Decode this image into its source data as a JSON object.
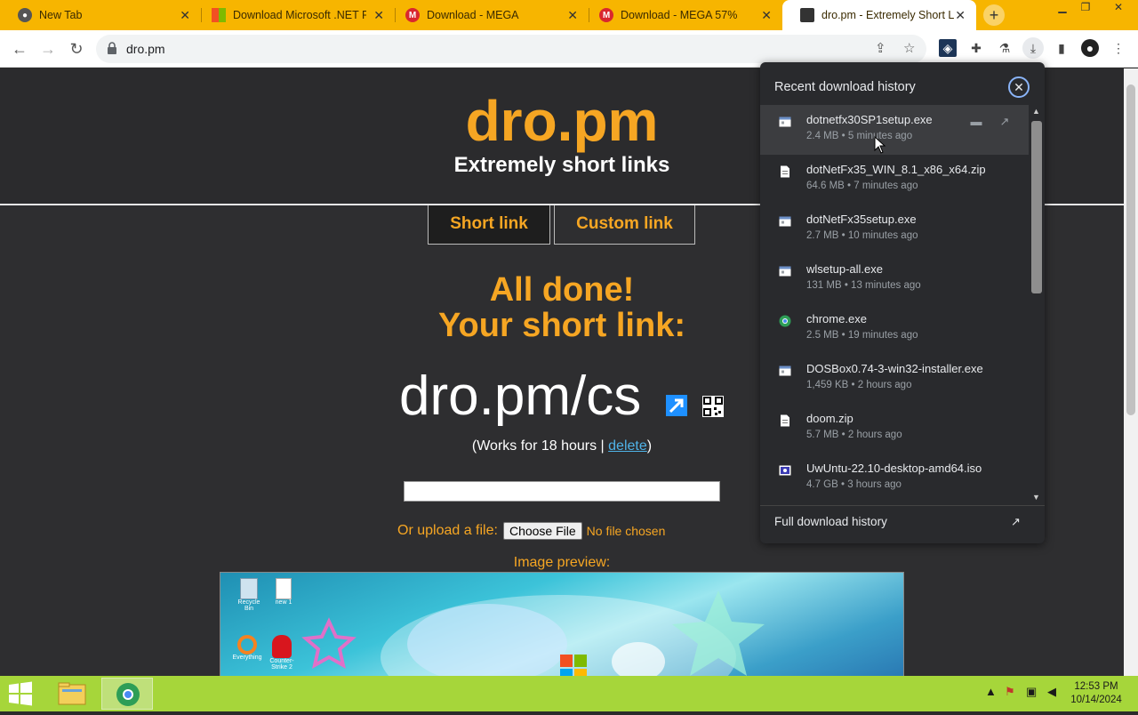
{
  "browser": {
    "tabs": [
      {
        "title": "New Tab",
        "favicon": "chrome-icon",
        "active": false
      },
      {
        "title": "Download Microsoft .NET Fr",
        "favicon": "microsoft-icon",
        "active": false
      },
      {
        "title": "Download - MEGA",
        "favicon": "mega-icon",
        "active": false
      },
      {
        "title": "Download - MEGA 57%",
        "favicon": "mega-icon",
        "active": false
      },
      {
        "title": "dro.pm - Extremely Short Li",
        "favicon": "dropm-icon",
        "active": true
      }
    ],
    "new_tab_label": "+",
    "url": "dro.pm"
  },
  "page": {
    "logo": "dro.pm",
    "tagline": "Extremely short links",
    "nav_tabs": [
      {
        "label": "Short link",
        "selected": true
      },
      {
        "label": "Custom link",
        "selected": false
      }
    ],
    "done_line1": "All done!",
    "done_line2": "Your short link:",
    "short_link": "dro.pm/cs",
    "works_prefix": "(Works for 18 hours | ",
    "delete_label": "delete",
    "works_suffix": ")",
    "textbox_value": "",
    "upload_label": "Or upload a file:",
    "choose_file_label": "Choose File",
    "no_file_label": "No file chosen",
    "preview_label": "Image preview:",
    "preview_desktop_icons": [
      "Recycle Bin",
      "new 1",
      "Everything",
      "Counter-Strike 2"
    ]
  },
  "downloads": {
    "title": "Recent download history",
    "items": [
      {
        "name": "dotnetfx30SP1setup.exe",
        "meta": "2.4 MB • 5 minutes ago",
        "icon": "exe-icon"
      },
      {
        "name": "dotNetFx35_WIN_8.1_x86_x64.zip",
        "meta": "64.6 MB • 7 minutes ago",
        "icon": "file-icon"
      },
      {
        "name": "dotNetFx35setup.exe",
        "meta": "2.7 MB • 10 minutes ago",
        "icon": "exe-icon"
      },
      {
        "name": "wlsetup-all.exe",
        "meta": "131 MB • 13 minutes ago",
        "icon": "exe-icon"
      },
      {
        "name": "chrome.exe",
        "meta": "2.5 MB • 19 minutes ago",
        "icon": "chrome-icon"
      },
      {
        "name": "DOSBox0.74-3-win32-installer.exe",
        "meta": "1,459 KB • 2 hours ago",
        "icon": "exe-icon"
      },
      {
        "name": "doom.zip",
        "meta": "5.7 MB • 2 hours ago",
        "icon": "file-icon"
      },
      {
        "name": "UwUntu-22.10-desktop-amd64.iso",
        "meta": "4.7 GB • 3 hours ago",
        "icon": "iso-icon"
      }
    ],
    "footer": "Full download history"
  },
  "taskbar": {
    "time": "12:53 PM",
    "date": "10/14/2024"
  },
  "colors": {
    "accent": "#f6a623",
    "tabstrip": "#f7b500",
    "taskbar": "#a6d63a"
  }
}
